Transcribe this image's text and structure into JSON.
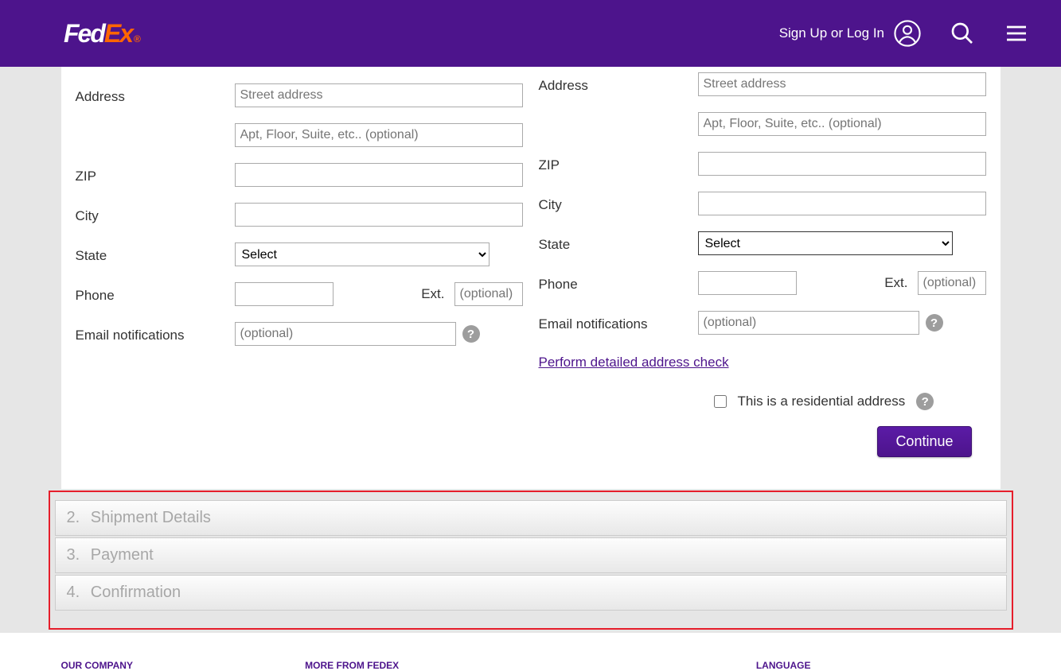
{
  "header": {
    "signin_label": "Sign Up or Log In"
  },
  "from": {
    "labels": {
      "address": "Address",
      "zip": "ZIP",
      "city": "City",
      "state": "State",
      "phone": "Phone",
      "ext": "Ext.",
      "email": "Email notifications"
    },
    "placeholders": {
      "street": "Street address",
      "apt": "Apt, Floor, Suite, etc.. (optional)",
      "ext": "(optional)",
      "email": "(optional)"
    },
    "state_select": "Select"
  },
  "to": {
    "labels": {
      "address": "Address",
      "zip": "ZIP",
      "city": "City",
      "state": "State",
      "phone": "Phone",
      "ext": "Ext.",
      "email": "Email notifications"
    },
    "placeholders": {
      "street": "Street address",
      "apt": "Apt, Floor, Suite, etc.. (optional)",
      "ext": "(optional)",
      "email": "(optional)"
    },
    "state_select": "Select",
    "address_check_link": "Perform detailed address check",
    "residential_label": "This is a residential address"
  },
  "buttons": {
    "continue": "Continue"
  },
  "steps": [
    {
      "num": "2.",
      "label": "Shipment Details"
    },
    {
      "num": "3.",
      "label": "Payment"
    },
    {
      "num": "4.",
      "label": "Confirmation"
    }
  ],
  "footer": {
    "col1": "OUR COMPANY",
    "col2": "MORE FROM FEDEX",
    "col3": "LANGUAGE"
  }
}
